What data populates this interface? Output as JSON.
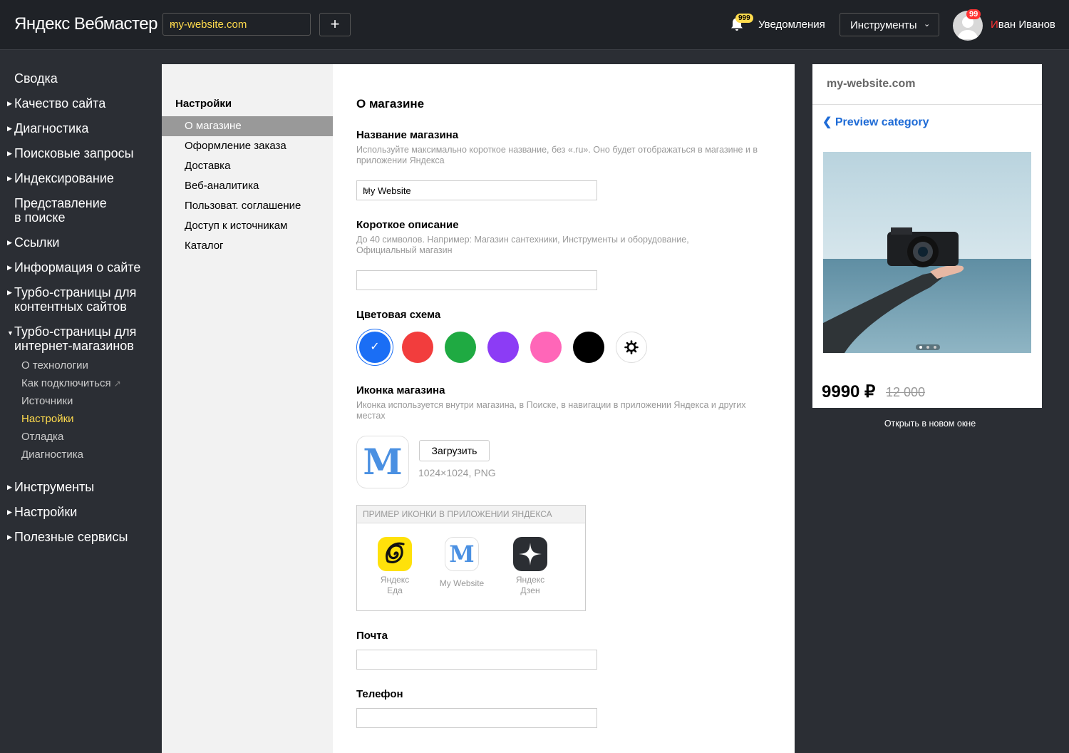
{
  "header": {
    "logo_yandex": "Яндекс",
    "logo_product": "Вебмастер",
    "site": "my-website.com",
    "add_label": "+",
    "notifications_badge": "999",
    "notifications_label": "Уведомления",
    "tools_label": "Инструменты",
    "avatar_badge": "99",
    "user_first_letter": "И",
    "user_rest": "ван Иванов"
  },
  "sidebar": {
    "items": [
      {
        "label": "Сводка"
      },
      {
        "label": "Качество сайта"
      },
      {
        "label": "Диагностика"
      },
      {
        "label": "Поисковые запросы"
      },
      {
        "label": "Индексирование"
      },
      {
        "label": "Представление\nв поиске"
      },
      {
        "label": "Ссылки"
      },
      {
        "label": "Информация о сайте"
      },
      {
        "label": "Турбо-страницы для\nконтентных сайтов"
      },
      {
        "label": "Турбо-страницы для\nинтернет-магазинов"
      },
      {
        "label": "Инструменты"
      },
      {
        "label": "Настройки"
      },
      {
        "label": "Полезные сервисы"
      }
    ],
    "sub_items": [
      {
        "label": "О технологии"
      },
      {
        "label": "Как подключиться"
      },
      {
        "label": "Источники"
      },
      {
        "label": "Настройки"
      },
      {
        "label": "Отладка"
      },
      {
        "label": "Диагностика"
      }
    ]
  },
  "settings_menu": {
    "title": "Настройки",
    "items": [
      {
        "label": "О магазине"
      },
      {
        "label": "Оформление заказа"
      },
      {
        "label": "Доставка"
      },
      {
        "label": "Веб-аналитика"
      },
      {
        "label": "Пользоват. соглашение"
      },
      {
        "label": "Доступ к источникам"
      },
      {
        "label": "Каталог"
      }
    ]
  },
  "form": {
    "title": "О магазине",
    "name": {
      "label": "Название магазина",
      "hint": "Используйте максимально короткое название, без «.ru». Оно будет отображаться в магазине и в приложении Яндекса",
      "value": "My Website"
    },
    "description": {
      "label": "Короткое описание",
      "hint": "До 40 символов. Например: Магазин сантехники, Инструменты и оборудование, Официальный магазин",
      "value": ""
    },
    "color_scheme": {
      "label": "Цветовая схема",
      "colors": [
        "#1a6ef5",
        "#f23d3d",
        "#1faa42",
        "#8c3cf5",
        "#ff66b8",
        "#000000"
      ],
      "selected": 0
    },
    "icon": {
      "label": "Иконка магазина",
      "hint": "Иконка используется внутри магазина, в Поиске, в навигации в приложении Яндекса и других местах",
      "letter": "M",
      "upload_label": "Загрузить",
      "size_hint": "1024×1024, PNG"
    },
    "example": {
      "title": "ПРИМЕР ИКОНКИ В ПРИЛОЖЕНИИ ЯНДЕКСА",
      "apps": [
        {
          "label": "Яндекс\nЕда"
        },
        {
          "label": "My Website"
        },
        {
          "label": "Яндекс\nДзен"
        }
      ]
    },
    "email": {
      "label": "Почта",
      "value": ""
    },
    "phone": {
      "label": "Телефон",
      "value": ""
    }
  },
  "preview": {
    "domain": "my-website.com",
    "category": "Preview category",
    "price": "9990 ₽",
    "old_price": "12 000",
    "open_new": "Открыть в новом окне"
  }
}
